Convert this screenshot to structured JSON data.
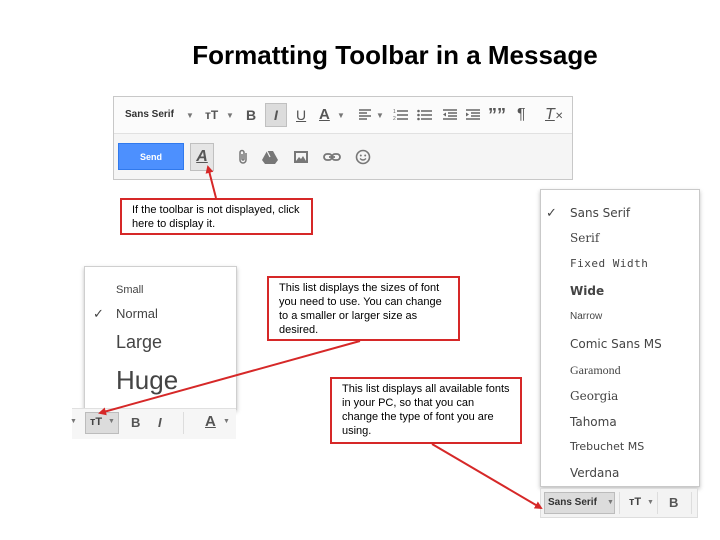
{
  "title": "Formatting Toolbar in a Message",
  "compose_toolbar": {
    "font_family": "Sans Serif",
    "size_icon": "тT",
    "bold": "B",
    "italic": "I",
    "underline": "U",
    "text_color": "A",
    "quote": "””",
    "rtl": "¶",
    "clear_format": "T",
    "send_label": "Send",
    "format_toggle": "A"
  },
  "callouts": {
    "toolbar_hint": "If the toolbar is not displayed, click here to display it.",
    "size_hint": "This list displays the sizes of font you need to use. You can change to a smaller or larger size as desired.",
    "font_hint": "This list displays all available fonts in your PC, so that you can change the type of font you are using."
  },
  "size_menu": {
    "items": [
      "Small",
      "Normal",
      "Large",
      "Huge"
    ],
    "selected": "Normal",
    "bar_size_icon": "тT",
    "bar_bold": "B",
    "bar_italic": "I",
    "bar_color": "A"
  },
  "font_menu": {
    "items": [
      "Sans Serif",
      "Serif",
      "Fixed Width",
      "Wide",
      "Narrow",
      "Comic Sans MS",
      "Garamond",
      "Georgia",
      "Tahoma",
      "Trebuchet MS",
      "Verdana"
    ],
    "selected": "Sans Serif",
    "bar_font": "Sans Serif",
    "bar_size_icon": "тT",
    "bar_bold": "B"
  },
  "colors": {
    "accent_red": "#d62828",
    "send_blue": "#4d90fe"
  },
  "icons": [
    "attach-icon",
    "drive-icon",
    "photo-icon",
    "link-icon",
    "emoji-icon",
    "align-icon",
    "numbered-list-icon",
    "bulleted-list-icon",
    "indent-less-icon",
    "indent-more-icon",
    "check-icon"
  ]
}
